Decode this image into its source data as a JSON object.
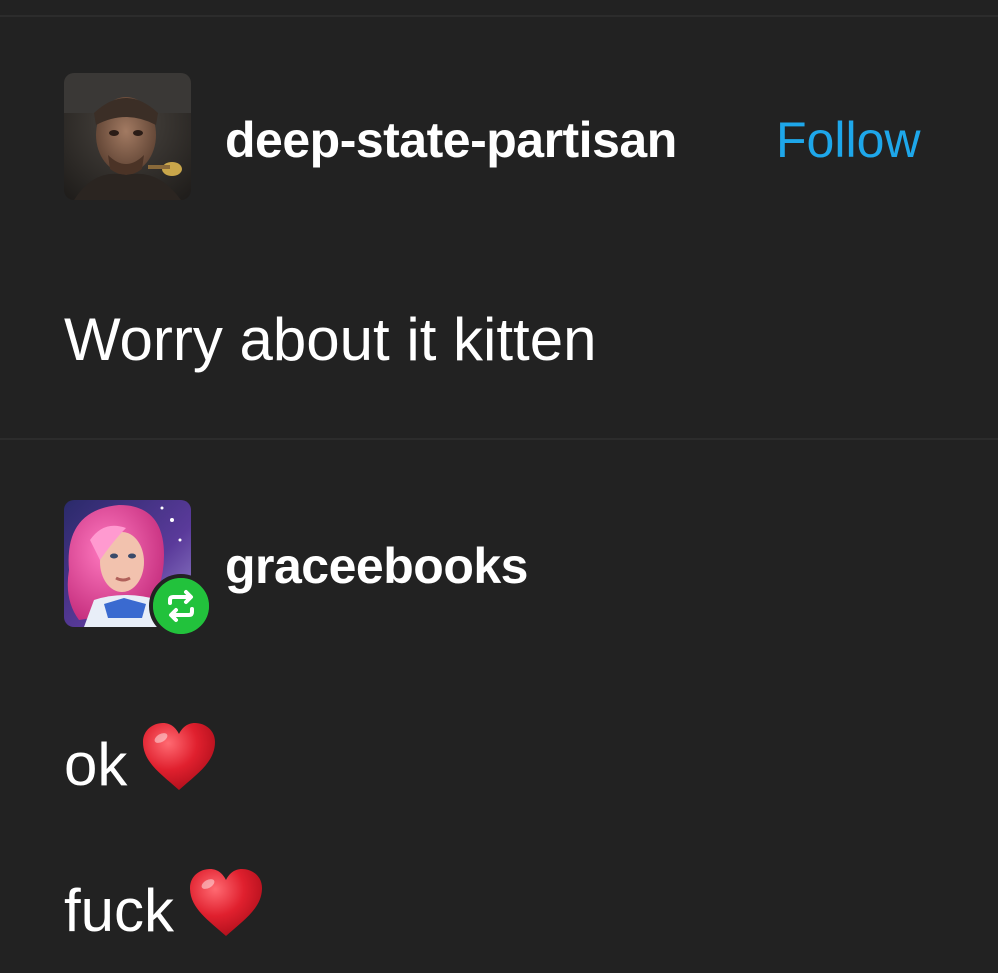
{
  "posts": [
    {
      "username": "deep-state-partisan",
      "follow_label": "Follow",
      "text": "Worry about it kitten"
    },
    {
      "username": "graceebooks",
      "lines": [
        "ok",
        "fuck"
      ],
      "reblog_icon": "reblog-icon"
    }
  ],
  "colors": {
    "background": "#222222",
    "divider": "#2c2c2c",
    "follow": "#1ea7ea",
    "reblog_badge": "#22c23c",
    "heart": "#e0202e"
  }
}
